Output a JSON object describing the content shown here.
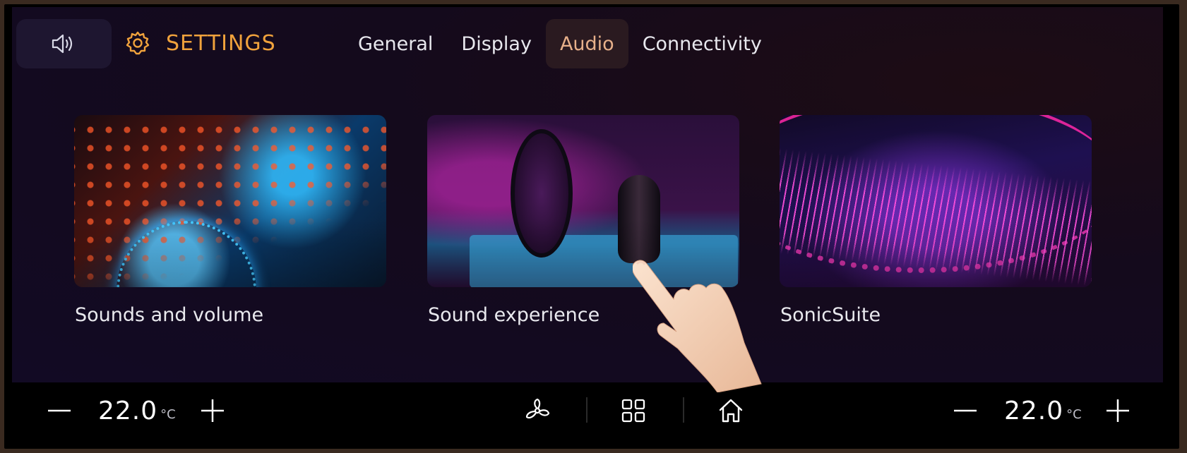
{
  "header": {
    "title": "SETTINGS",
    "tabs": [
      {
        "label": "General",
        "active": false
      },
      {
        "label": "Display",
        "active": false
      },
      {
        "label": "Audio",
        "active": true
      },
      {
        "label": "Connectivity",
        "active": false
      }
    ]
  },
  "cards": [
    {
      "label": "Sounds and volume",
      "image": "dj-mixer-image"
    },
    {
      "label": "Sound experience",
      "image": "studio-microphone-image"
    },
    {
      "label": "SonicSuite",
      "image": "speaker-cone-image"
    }
  ],
  "climate": {
    "left": {
      "value": "22.0",
      "unit": "°C"
    },
    "right": {
      "value": "22.0",
      "unit": "°C"
    }
  },
  "colors": {
    "accent": "#f0a23c",
    "active_tab_bg": "#2a1a20",
    "active_tab_text": "#e7b08a",
    "screen_bg": "#140a1c"
  },
  "icons": [
    "speaker-icon",
    "gear-icon",
    "minus-icon",
    "plus-icon",
    "fan-icon",
    "grid-icon",
    "home-icon"
  ]
}
